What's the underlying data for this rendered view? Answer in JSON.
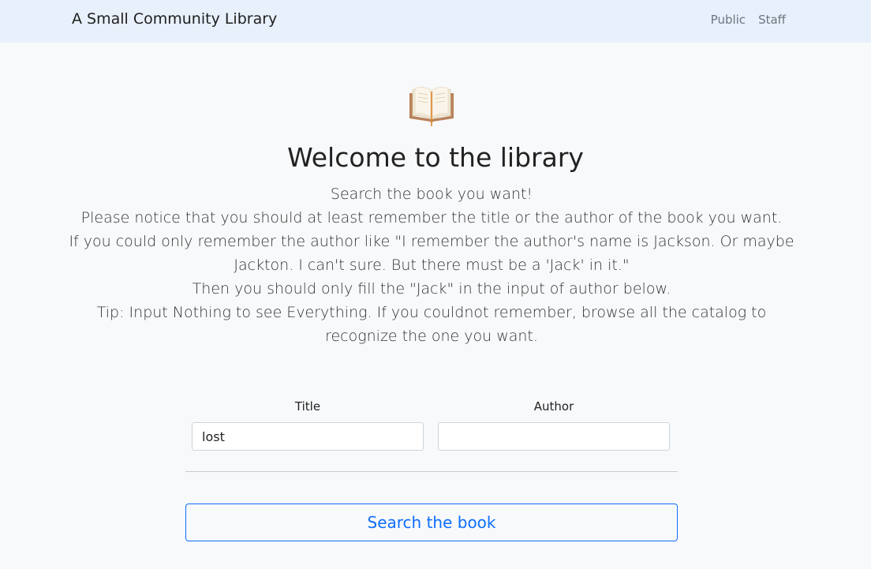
{
  "navbar": {
    "brand": "A Small Community Library",
    "links": [
      "Public",
      "Staff"
    ]
  },
  "hero": {
    "logo_icon": "open-book-icon",
    "title": "Welcome to the library",
    "lines": [
      "Search the book you want!",
      "Please notice that you should at least remember the title or the author of the book you want.",
      "If you could only remember the author like \"I remember the author's name is Jackson. Or maybe Jackton. I can't sure. But there must be a 'Jack' in it.\"",
      "Then you should only fill the \"Jack\" in the input of author below.",
      "Tip: Input Nothing to see Everything. If you couldnot remember, browse all the catalog to recognize the one you want."
    ]
  },
  "form": {
    "title_label": "Title",
    "title_value": "lost",
    "author_label": "Author",
    "author_value": "",
    "submit_label": "Search the book"
  },
  "colors": {
    "navbar_bg": "#e8f0fb",
    "page_bg": "#f8f9fb",
    "accent": "#0d6efd"
  }
}
